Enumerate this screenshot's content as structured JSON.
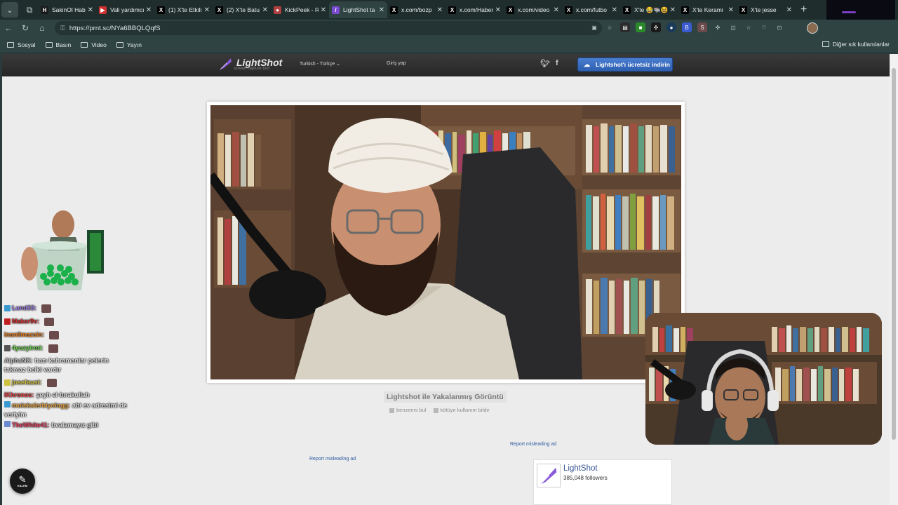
{
  "browser": {
    "tabs": [
      {
        "title": "SakinOl Haber",
        "fav_color": "#1a1a1a",
        "fav_glyph": "H"
      },
      {
        "title": "Vali yardımcısı",
        "fav_color": "#d03030",
        "fav_glyph": "▶"
      },
      {
        "title": "(1) X'te Etkili",
        "fav_color": "#000000",
        "fav_glyph": "X"
      },
      {
        "title": "(2) X'te Batu",
        "fav_color": "#000000",
        "fav_glyph": "X"
      },
      {
        "title": "KickPeek - R",
        "fav_color": "#b04040",
        "fav_glyph": "●"
      },
      {
        "title": "LightShot ta",
        "fav_color": "#7a4ad0",
        "fav_glyph": "/",
        "active": true
      },
      {
        "title": "x.com/bozp",
        "fav_color": "#000000",
        "fav_glyph": "X"
      },
      {
        "title": "x.com/Haber",
        "fav_color": "#000000",
        "fav_glyph": "X"
      },
      {
        "title": "x.com/video",
        "fav_color": "#000000",
        "fav_glyph": "X"
      },
      {
        "title": "x.com/futbo",
        "fav_color": "#000000",
        "fav_glyph": "X"
      },
      {
        "title": "X'te 😂🐃😆",
        "fav_color": "#000000",
        "fav_glyph": "X"
      },
      {
        "title": "X'te Kerami",
        "fav_color": "#000000",
        "fav_glyph": "X"
      },
      {
        "title": "X'te jesse",
        "fav_color": "#000000",
        "fav_glyph": "X"
      }
    ],
    "url": "https://prnt.sc/NYa6BBQLQqfS",
    "bookmarks": [
      "Sosyal",
      "Basın",
      "Video",
      "Yayın"
    ],
    "other_bookmarks": "Diğer sık kullanılanlar"
  },
  "lightshot": {
    "logo": "LightShot",
    "tagline": "screen capture tool",
    "language": "Turkish - Türkçe",
    "login": "Giriş yap",
    "download": "Lightshot'ı ücretsiz indirin",
    "caption": "Lightshot ile Yakalanmış Görüntü",
    "find_similar": "benzerini bul",
    "report_abuse": "kötüye kullanım bildir",
    "report_ad_1": "Report misleading ad",
    "report_ad_2": "Report misleading ad",
    "fb_name": "LightShot",
    "fb_followers": "385,048 followers"
  },
  "chat": [
    {
      "user": "Lund33:",
      "color": "#9a7ae0",
      "msg": "",
      "badge": "#3a9ad0"
    },
    {
      "user": "Maker9v:",
      "color": "#d03030",
      "msg": "",
      "badge": "#c02020"
    },
    {
      "user": "inanilmazsin:",
      "color": "#e07a20",
      "msg": "",
      "badge": ""
    },
    {
      "user": "4yuzyirmi:",
      "color": "#6ad04a",
      "msg": "",
      "badge": "#555555"
    },
    {
      "user": "AlphaNX:",
      "color": "#bdbdbd",
      "msg": "bazı kahramanlar pelerin takmaz belki vardır",
      "badge": ""
    },
    {
      "user": "josefaust:",
      "color": "#d0c040",
      "msg": "",
      "badge": "#d0c040"
    },
    {
      "user": "lKhronos:",
      "color": "#e04040",
      "msg": "şeyh el-bırakullah",
      "badge": ""
    },
    {
      "user": "molekulerbiyologg:",
      "color": "#e0a040",
      "msg": "abi ev adresimi de veriyim",
      "badge": "#3a9ad0"
    },
    {
      "user": "TheWhite41:",
      "color": "#e04060",
      "msg": "bvalamayız gibi",
      "badge": "#6a8ad0"
    }
  ],
  "overlay": {
    "pen_label": "KALEM"
  }
}
